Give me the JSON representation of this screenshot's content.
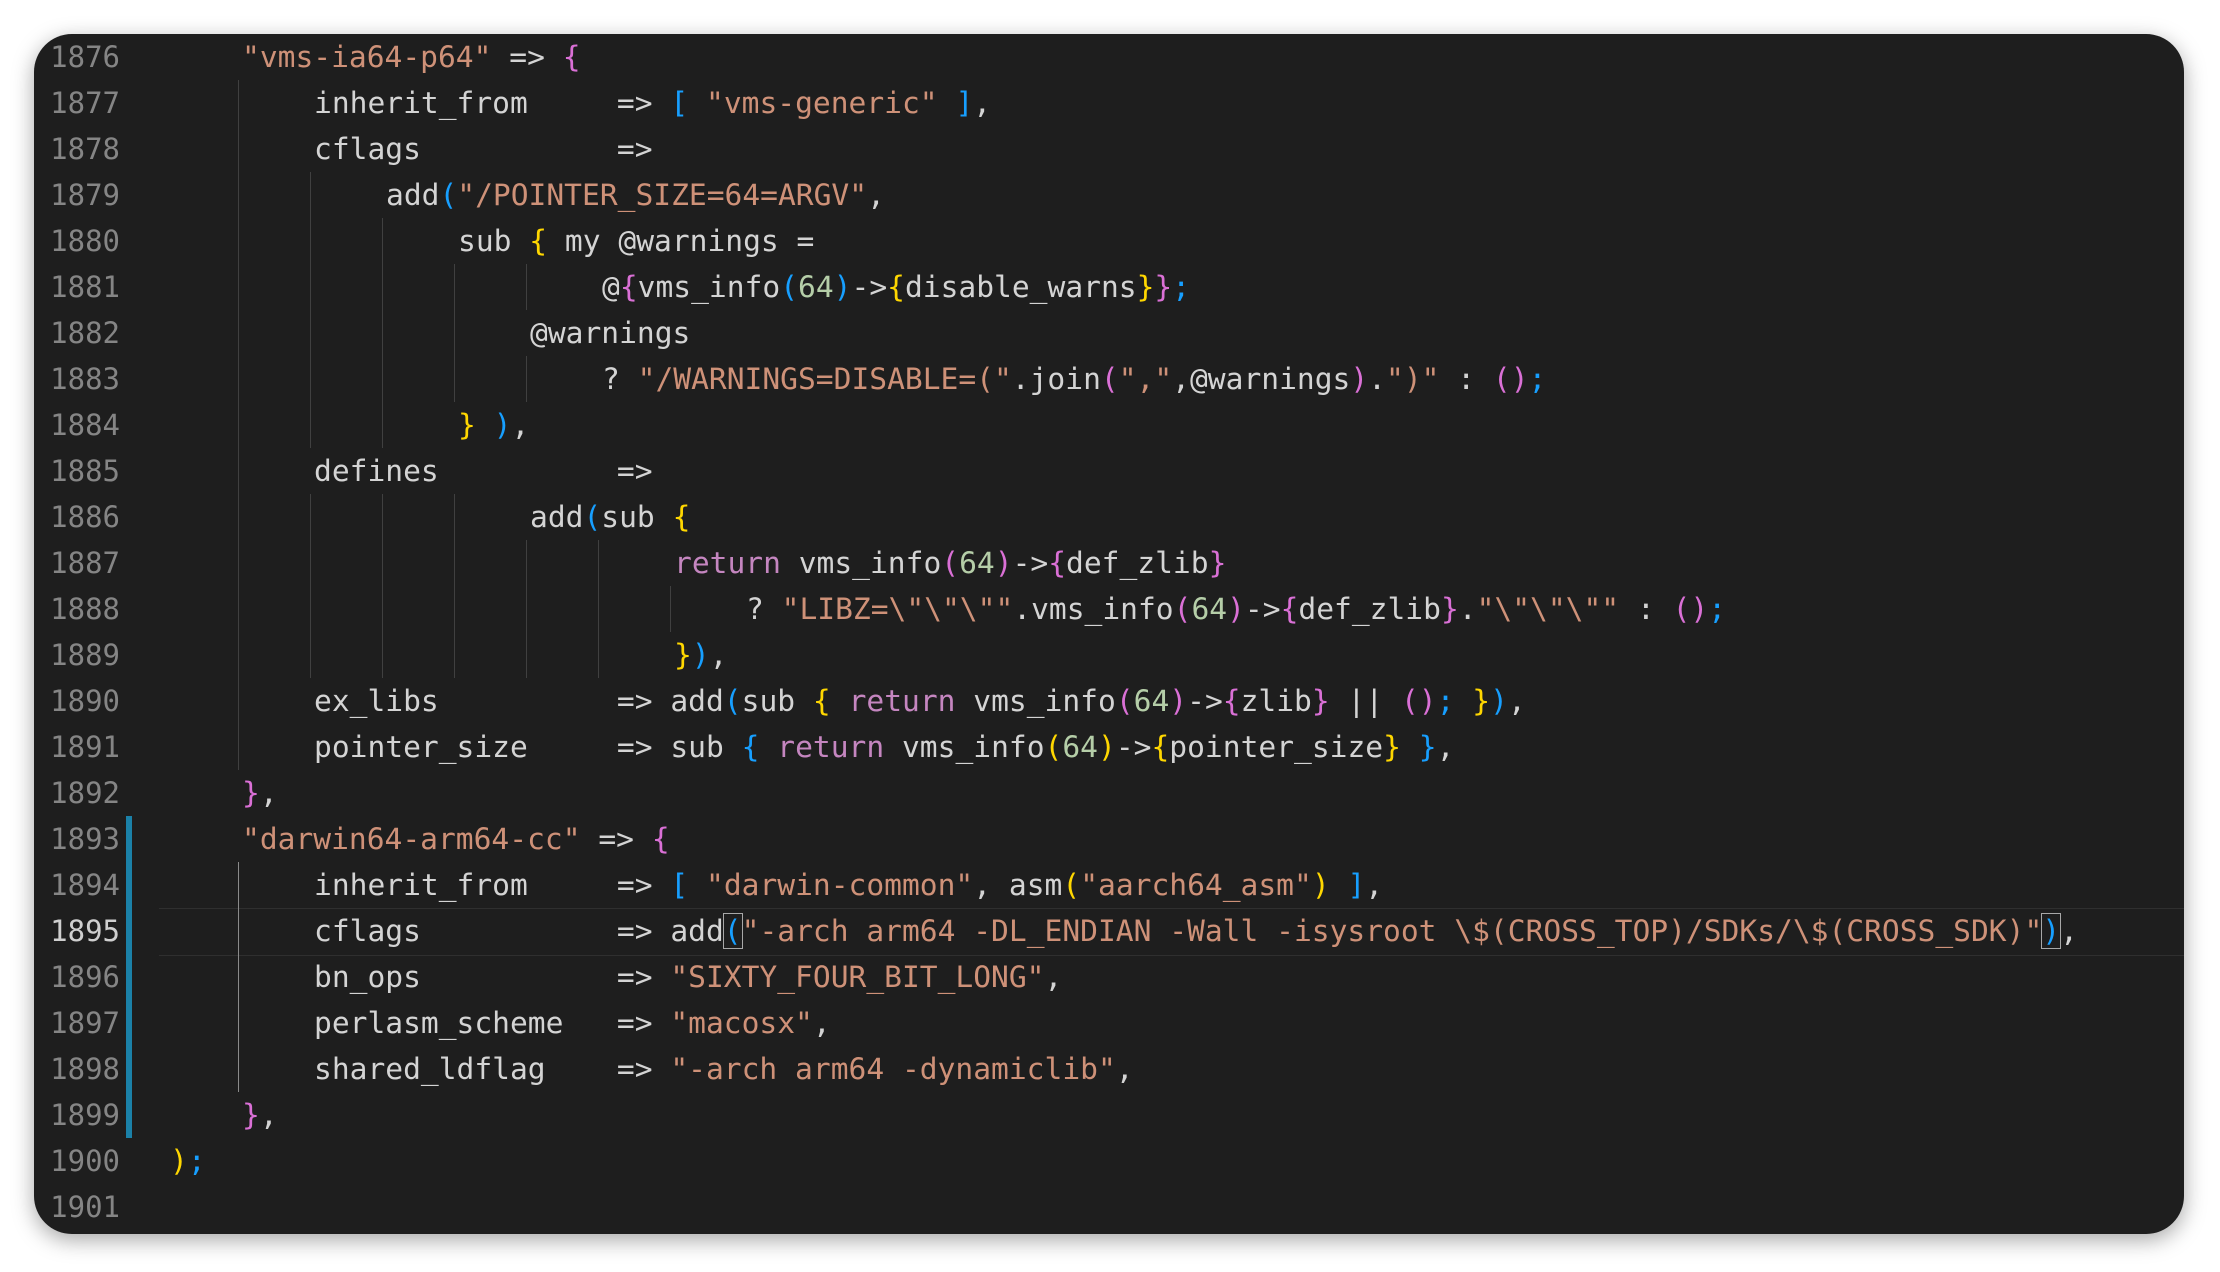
{
  "colors": {
    "background": "#1e1e1e",
    "text": "#d4d4d4",
    "line_number": "#858585",
    "line_number_active": "#cfcfcf",
    "gutter_modified": "#1b81a8",
    "c": {
      "t": "#d4d4d4",
      "s": "#ce9178",
      "k": "#c586c0",
      "n": "#b5cea8",
      "y": "#ffd700",
      "m": "#da70d6",
      "b": "#179fff"
    }
  },
  "editor": {
    "active_line": "1895",
    "lines": [
      {
        "n": "1876",
        "ind": 1,
        "tok": [
          [
            "\"vms-ia64-p64\"",
            "s"
          ],
          [
            " => ",
            "t"
          ],
          [
            "{",
            "m"
          ]
        ]
      },
      {
        "n": "1877",
        "ind": 2,
        "tok": [
          [
            "inherit_from     => ",
            "t"
          ],
          [
            "[",
            "b"
          ],
          [
            " ",
            "t"
          ],
          [
            "\"vms-generic\"",
            "s"
          ],
          [
            " ",
            "t"
          ],
          [
            "]",
            "b"
          ],
          [
            ",",
            "t"
          ]
        ]
      },
      {
        "n": "1878",
        "ind": 2,
        "tok": [
          [
            "cflags           =>",
            "t"
          ]
        ]
      },
      {
        "n": "1879",
        "ind": 3,
        "tok": [
          [
            "add",
            "t"
          ],
          [
            "(",
            "b"
          ],
          [
            "\"/POINTER_SIZE=64=ARGV\"",
            "s"
          ],
          [
            ",",
            "t"
          ]
        ]
      },
      {
        "n": "1880",
        "ind": 4,
        "tok": [
          [
            "sub ",
            "t"
          ],
          [
            "{",
            "y"
          ],
          [
            " my @warnings =",
            "t"
          ]
        ]
      },
      {
        "n": "1881",
        "ind": 6,
        "tok": [
          [
            "@",
            "t"
          ],
          [
            "{",
            "m"
          ],
          [
            "vms_info",
            "t"
          ],
          [
            "(",
            "b"
          ],
          [
            "64",
            "n"
          ],
          [
            ")",
            "b"
          ],
          [
            "->",
            "t"
          ],
          [
            "{",
            "y"
          ],
          [
            "disable_warns",
            "t"
          ],
          [
            "}",
            "y"
          ],
          [
            "}",
            "m"
          ],
          [
            ";",
            "b"
          ]
        ]
      },
      {
        "n": "1882",
        "ind": 5,
        "tok": [
          [
            "@warnings",
            "t"
          ]
        ]
      },
      {
        "n": "1883",
        "ind": 6,
        "tok": [
          [
            "? ",
            "t"
          ],
          [
            "\"/WARNINGS=DISABLE=(\"",
            "s"
          ],
          [
            ".join",
            "t"
          ],
          [
            "(",
            "m"
          ],
          [
            "\",\"",
            "s"
          ],
          [
            ",@warnings",
            "t"
          ],
          [
            ")",
            "m"
          ],
          [
            ".",
            "t"
          ],
          [
            "\")\"",
            "s"
          ],
          [
            " : ",
            "t"
          ],
          [
            "()",
            "m"
          ],
          [
            ";",
            "b"
          ]
        ]
      },
      {
        "n": "1884",
        "ind": 4,
        "tok": [
          [
            "}",
            "y"
          ],
          [
            " ",
            "t"
          ],
          [
            ")",
            "b"
          ],
          [
            ",",
            "t"
          ]
        ]
      },
      {
        "n": "1885",
        "ind": 2,
        "tok": [
          [
            "defines          =>",
            "t"
          ]
        ]
      },
      {
        "n": "1886",
        "ind": 5,
        "tok": [
          [
            "add",
            "t"
          ],
          [
            "(",
            "b"
          ],
          [
            "sub ",
            "t"
          ],
          [
            "{",
            "y"
          ]
        ]
      },
      {
        "n": "1887",
        "ind": 7,
        "tok": [
          [
            "return",
            "k"
          ],
          [
            " vms_info",
            "t"
          ],
          [
            "(",
            "m"
          ],
          [
            "64",
            "n"
          ],
          [
            ")",
            "m"
          ],
          [
            "->",
            "t"
          ],
          [
            "{",
            "m"
          ],
          [
            "def_zlib",
            "t"
          ],
          [
            "}",
            "m"
          ]
        ]
      },
      {
        "n": "1888",
        "ind": 8,
        "tok": [
          [
            "? ",
            "t"
          ],
          [
            "\"LIBZ=\\\"\\\"\\\"\"",
            "s"
          ],
          [
            ".vms_info",
            "t"
          ],
          [
            "(",
            "m"
          ],
          [
            "64",
            "n"
          ],
          [
            ")",
            "m"
          ],
          [
            "->",
            "t"
          ],
          [
            "{",
            "m"
          ],
          [
            "def_zlib",
            "t"
          ],
          [
            "}",
            "m"
          ],
          [
            ".",
            "t"
          ],
          [
            "\"\\\"\\\"\\\"\"",
            "s"
          ],
          [
            " : ",
            "t"
          ],
          [
            "()",
            "m"
          ],
          [
            ";",
            "b"
          ]
        ]
      },
      {
        "n": "1889",
        "ind": 7,
        "tok": [
          [
            "}",
            "y"
          ],
          [
            ")",
            "b"
          ],
          [
            ",",
            "t"
          ]
        ]
      },
      {
        "n": "1890",
        "ind": 2,
        "tok": [
          [
            "ex_libs          => add",
            "t"
          ],
          [
            "(",
            "b"
          ],
          [
            "sub ",
            "t"
          ],
          [
            "{",
            "y"
          ],
          [
            " ",
            "t"
          ],
          [
            "return",
            "k"
          ],
          [
            " vms_info",
            "t"
          ],
          [
            "(",
            "m"
          ],
          [
            "64",
            "n"
          ],
          [
            ")",
            "m"
          ],
          [
            "->",
            "t"
          ],
          [
            "{",
            "m"
          ],
          [
            "zlib",
            "t"
          ],
          [
            "}",
            "m"
          ],
          [
            " || ",
            "t"
          ],
          [
            "()",
            "m"
          ],
          [
            ";",
            "b"
          ],
          [
            " ",
            "t"
          ],
          [
            "}",
            "y"
          ],
          [
            ")",
            "b"
          ],
          [
            ",",
            "t"
          ]
        ]
      },
      {
        "n": "1891",
        "ind": 2,
        "tok": [
          [
            "pointer_size     => sub ",
            "t"
          ],
          [
            "{",
            "b"
          ],
          [
            " ",
            "t"
          ],
          [
            "return",
            "k"
          ],
          [
            " vms_info",
            "t"
          ],
          [
            "(",
            "y"
          ],
          [
            "64",
            "n"
          ],
          [
            ")",
            "y"
          ],
          [
            "->",
            "t"
          ],
          [
            "{",
            "y"
          ],
          [
            "pointer_size",
            "t"
          ],
          [
            "}",
            "y"
          ],
          [
            " ",
            "t"
          ],
          [
            "}",
            "b"
          ],
          [
            ",",
            "t"
          ]
        ]
      },
      {
        "n": "1892",
        "ind": 1,
        "tok": [
          [
            "}",
            "m"
          ],
          [
            ",",
            "t"
          ]
        ]
      },
      {
        "n": "1893",
        "ind": 1,
        "tok": [
          [
            "\"darwin64-arm64-cc\"",
            "s"
          ],
          [
            " => ",
            "t"
          ],
          [
            "{",
            "m"
          ]
        ]
      },
      {
        "n": "1894",
        "ind": 2,
        "tok": [
          [
            "inherit_from     => ",
            "t"
          ],
          [
            "[",
            "b"
          ],
          [
            " ",
            "t"
          ],
          [
            "\"darwin-common\"",
            "s"
          ],
          [
            ", asm",
            "t"
          ],
          [
            "(",
            "y"
          ],
          [
            "\"aarch64_asm\"",
            "s"
          ],
          [
            ")",
            "y"
          ],
          [
            " ",
            "t"
          ],
          [
            "]",
            "b"
          ],
          [
            ",",
            "t"
          ]
        ]
      },
      {
        "n": "1895",
        "ind": 2,
        "tok": [
          [
            "cflags           => add",
            "t"
          ],
          [
            "(",
            "bm"
          ],
          [
            "\"-arch arm64 -DL_ENDIAN -Wall -isysroot \\$(CROSS_TOP)/SDKs/\\$(CROSS_SDK)\"",
            "s"
          ],
          [
            ")",
            "bm"
          ],
          [
            ",",
            "t"
          ]
        ]
      },
      {
        "n": "1896",
        "ind": 2,
        "tok": [
          [
            "bn_ops           => ",
            "t"
          ],
          [
            "\"SIXTY_FOUR_BIT_LONG\"",
            "s"
          ],
          [
            ",",
            "t"
          ]
        ]
      },
      {
        "n": "1897",
        "ind": 2,
        "tok": [
          [
            "perlasm_scheme   => ",
            "t"
          ],
          [
            "\"macosx\"",
            "s"
          ],
          [
            ",",
            "t"
          ]
        ]
      },
      {
        "n": "1898",
        "ind": 2,
        "tok": [
          [
            "shared_ldflag    => ",
            "t"
          ],
          [
            "\"-arch arm64 -dynamiclib\"",
            "s"
          ],
          [
            ",",
            "t"
          ]
        ]
      },
      {
        "n": "1899",
        "ind": 1,
        "tok": [
          [
            "}",
            "m"
          ],
          [
            ",",
            "t"
          ]
        ]
      },
      {
        "n": "1900",
        "ind": 0,
        "tok": [
          [
            ")",
            "y"
          ],
          [
            ";",
            "b"
          ]
        ]
      },
      {
        "n": "1901",
        "ind": 0,
        "tok": []
      }
    ]
  }
}
